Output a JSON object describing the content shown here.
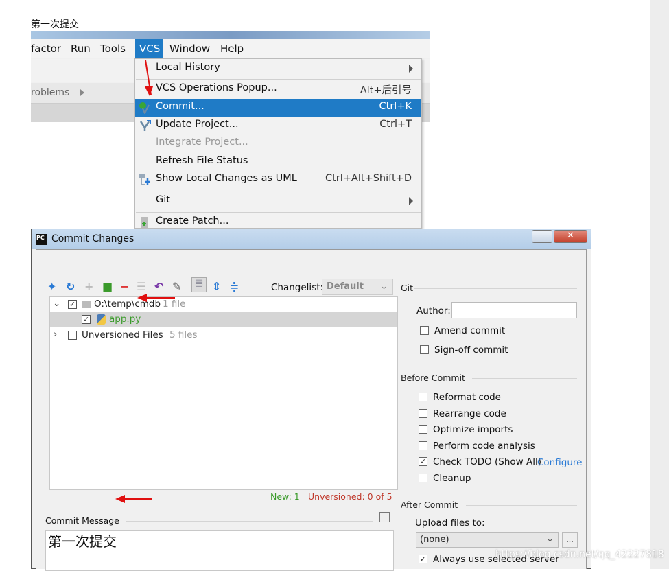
{
  "heading": "第一次提交",
  "ide": {
    "menubar": [
      "factor",
      "Run",
      "Tools",
      "VCS",
      "Window",
      "Help"
    ],
    "tab_label": "roblems"
  },
  "vcs_menu": {
    "items": [
      {
        "label": "Local History",
        "shortcut": "",
        "submenu": true
      },
      {
        "label": "VCS Operations Popup...",
        "shortcut": "Alt+后引号"
      },
      {
        "label": "Commit...",
        "shortcut": "Ctrl+K",
        "highlighted": true,
        "icon": "commit-icon"
      },
      {
        "label": "Update Project...",
        "shortcut": "Ctrl+T",
        "icon": "update-icon"
      },
      {
        "label": "Integrate Project...",
        "shortcut": "",
        "disabled": true
      },
      {
        "label": "Refresh File Status",
        "shortcut": ""
      },
      {
        "label": "Show Local Changes as UML",
        "shortcut": "Ctrl+Alt+Shift+D",
        "icon": "uml-icon"
      },
      {
        "label": "Git",
        "shortcut": "",
        "submenu": true
      },
      {
        "label": "Create Patch...",
        "shortcut": "",
        "icon": "patch-icon"
      }
    ]
  },
  "dialog": {
    "title": "Commit Changes",
    "app_icon": "PC",
    "changelist_label": "Changelist:",
    "changelist_value": "Default",
    "tree": {
      "root": {
        "label": "O:\\temp\\cmdb",
        "count": "1 file",
        "checked": true
      },
      "file": {
        "label": "app.py",
        "checked": true
      },
      "unversioned": {
        "label": "Unversioned Files",
        "count": "5 files",
        "checked": false
      }
    },
    "status_new": "New: 1",
    "status_unversioned": "Unversioned: 0 of 5",
    "commit_message_label": "Commit Message",
    "commit_message": "第一次提交",
    "git": {
      "header": "Git",
      "author_label": "Author:",
      "author_value": "",
      "amend": {
        "label": "Amend commit",
        "checked": false
      },
      "signoff": {
        "label": "Sign-off commit",
        "checked": false
      }
    },
    "before_commit": {
      "header": "Before Commit",
      "items": [
        {
          "label": "Reformat code",
          "checked": false
        },
        {
          "label": "Rearrange code",
          "checked": false
        },
        {
          "label": "Optimize imports",
          "checked": false
        },
        {
          "label": "Perform code analysis",
          "checked": false
        },
        {
          "label": "Check TODO (Show All)",
          "checked": true
        },
        {
          "label": "Cleanup",
          "checked": false
        }
      ],
      "configure_link": "Configure"
    },
    "after_commit": {
      "header": "After Commit",
      "upload_label": "Upload files to:",
      "upload_value": "(none)",
      "browse_label": "...",
      "always_use": {
        "label": "Always use selected server",
        "checked": true
      }
    }
  },
  "watermark_url": "https://blog.csdn.net/qq_42227818",
  "colors": {
    "highlight": "#1f7bc6",
    "new": "#3a9a2a",
    "unversioned": "#c0392b",
    "link": "#2a7ad5",
    "arrow": "#e01010"
  }
}
